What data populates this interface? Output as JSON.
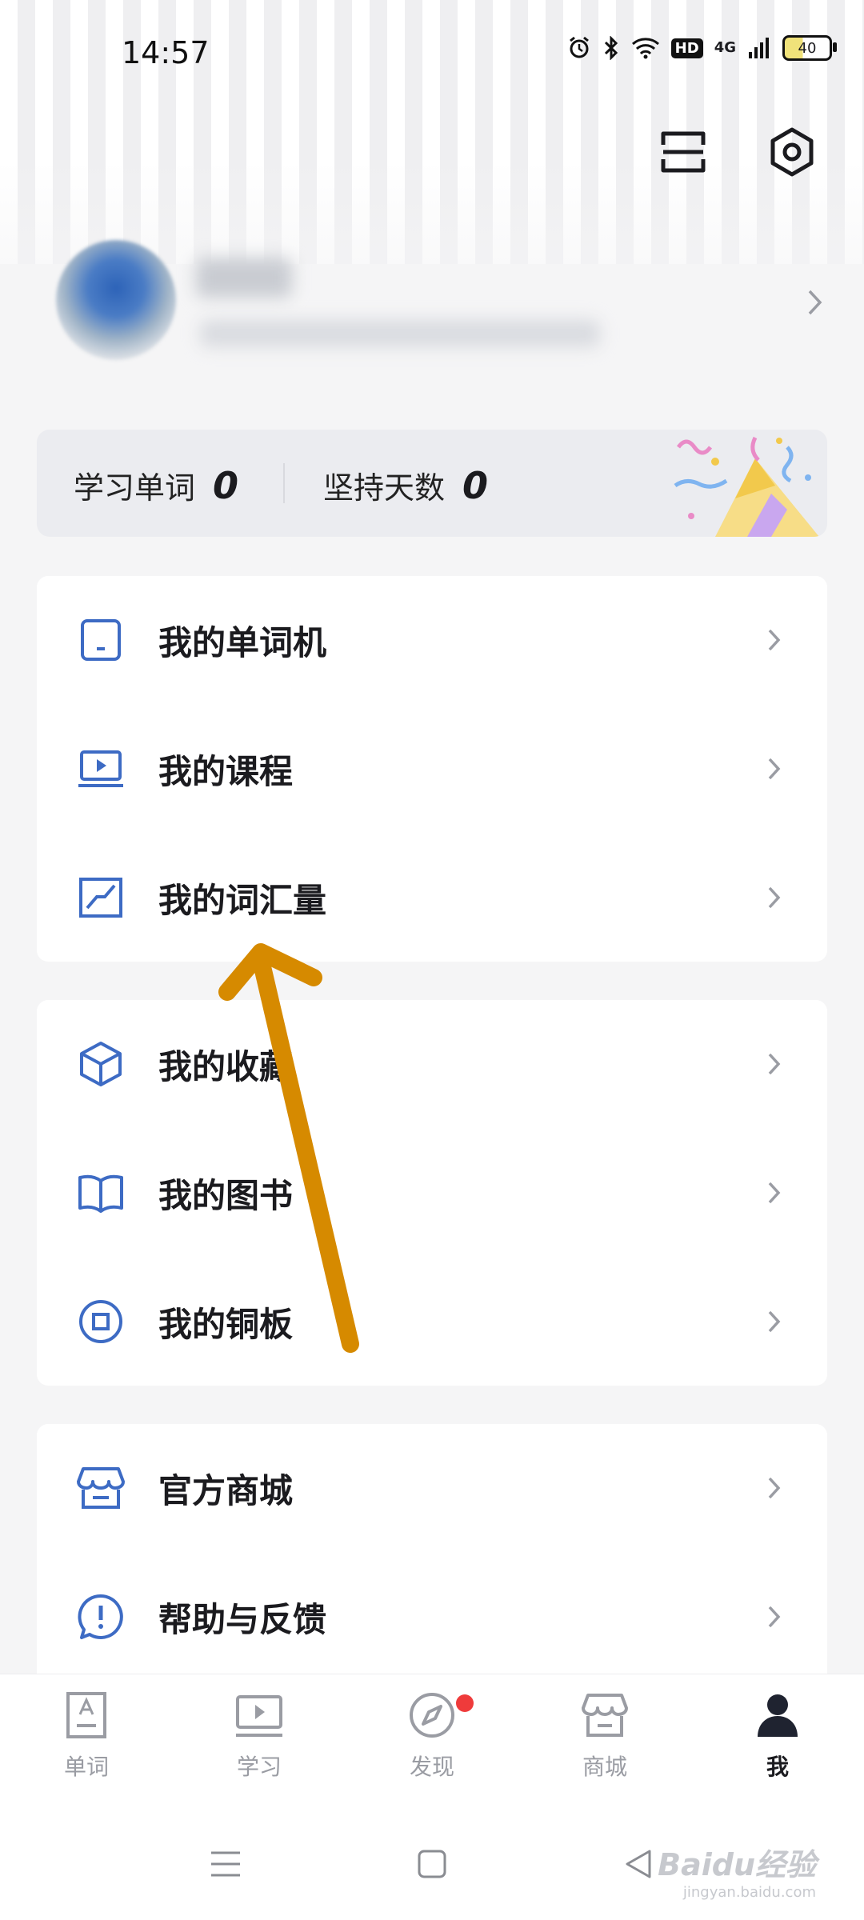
{
  "status_bar": {
    "time": "14:57",
    "network": "4G",
    "battery": "40"
  },
  "stats": {
    "words_label": "学习单词",
    "words_value": "0",
    "days_label": "坚持天数",
    "days_value": "0"
  },
  "menu_group_1": [
    {
      "label": "我的单词机",
      "icon": "device-icon"
    },
    {
      "label": "我的课程",
      "icon": "video-course-icon"
    },
    {
      "label": "我的词汇量",
      "icon": "chart-line-icon"
    }
  ],
  "menu_group_2": [
    {
      "label": "我的收藏",
      "icon": "cube-icon"
    },
    {
      "label": "我的图书",
      "icon": "book-icon"
    },
    {
      "label": "我的铜板",
      "icon": "coin-icon"
    }
  ],
  "menu_group_3": [
    {
      "label": "官方商城",
      "icon": "store-icon"
    },
    {
      "label": "帮助与反馈",
      "icon": "help-icon"
    }
  ],
  "tabbar": [
    {
      "label": "单词",
      "icon": "word-card-icon"
    },
    {
      "label": "学习",
      "icon": "play-screen-icon"
    },
    {
      "label": "发现",
      "icon": "compass-icon",
      "badge": "red-dot"
    },
    {
      "label": "商城",
      "icon": "store-icon"
    },
    {
      "label": "我",
      "icon": "user-icon",
      "active": true
    }
  ],
  "watermark": {
    "brand": "Baidu经验",
    "url": "jingyan.baidu.com"
  },
  "colors": {
    "accent": "#3d6bc4",
    "arrow": "#d68a00",
    "badge": "#ef3b3b"
  }
}
